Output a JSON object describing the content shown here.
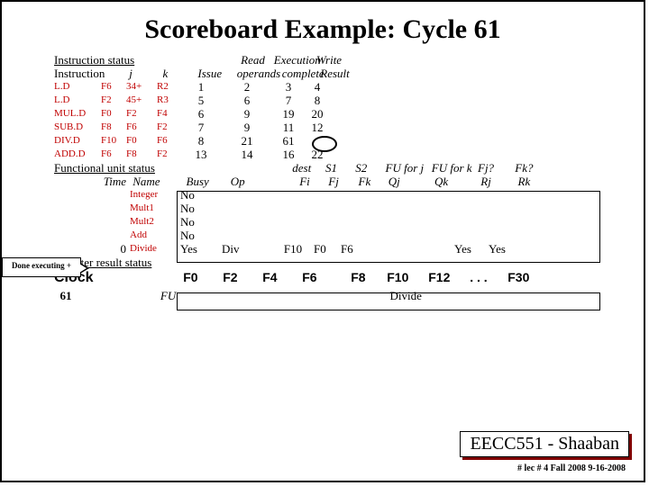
{
  "title": "Scoreboard Example:  Cycle 61",
  "headers": {
    "instr_status": "Instruction status",
    "instruction": "Instruction",
    "j": "j",
    "k": "k",
    "issue": "Issue",
    "read": "Read",
    "operands": "operands",
    "execution": "Execution",
    "complete": "complete",
    "write": "Write",
    "result": "Result",
    "fu_status": "Functional unit status",
    "time": "Time",
    "name": "Name",
    "busy": "Busy",
    "op": "Op",
    "dest": "dest",
    "fi": "Fi",
    "s1": "S1",
    "fj": "Fj",
    "s2": "S2",
    "fk": "Fk",
    "fu_j": "FU for j",
    "fu_k": "FU for k",
    "qj": "Qj",
    "qk": "Qk",
    "fjq": "Fj?",
    "rj": "Rj",
    "fkq": "Fk?",
    "rk": "Rk",
    "reg_status": "Register result status",
    "clock": "Clock",
    "fu": "FU"
  },
  "instructions": [
    {
      "op": "L.D",
      "dst": "F6",
      "j": "34+",
      "k": "R2",
      "issue": "1",
      "read": "2",
      "exec": "3",
      "write": "4"
    },
    {
      "op": "L.D",
      "dst": "F2",
      "j": "45+",
      "k": "R3",
      "issue": "5",
      "read": "6",
      "exec": "7",
      "write": "8"
    },
    {
      "op": "MUL.D",
      "dst": "F0",
      "j": "F2",
      "k": "F4",
      "issue": "6",
      "read": "9",
      "exec": "19",
      "write": "20"
    },
    {
      "op": "SUB.D",
      "dst": "F8",
      "j": "F6",
      "k": "F2",
      "issue": "7",
      "read": "9",
      "exec": "11",
      "write": "12"
    },
    {
      "op": "DIV.D",
      "dst": "F10",
      "j": "F0",
      "k": "F6",
      "issue": "8",
      "read": "21",
      "exec": "61",
      "write": ""
    },
    {
      "op": "ADD.D",
      "dst": "F6",
      "j": "F8",
      "k": "F2",
      "issue": "13",
      "read": "14",
      "exec": "16",
      "write": "22"
    }
  ],
  "fu_rows": [
    {
      "time": "",
      "name": "Integer",
      "busy": "No",
      "op": "",
      "fi": "",
      "fj": "",
      "fk": "",
      "qj": "",
      "qk": "",
      "rj": "",
      "rk": ""
    },
    {
      "time": "",
      "name": "Mult1",
      "busy": "No",
      "op": "",
      "fi": "",
      "fj": "",
      "fk": "",
      "qj": "",
      "qk": "",
      "rj": "",
      "rk": ""
    },
    {
      "time": "",
      "name": "Mult2",
      "busy": "No",
      "op": "",
      "fi": "",
      "fj": "",
      "fk": "",
      "qj": "",
      "qk": "",
      "rj": "",
      "rk": ""
    },
    {
      "time": "",
      "name": "Add",
      "busy": "No",
      "op": "",
      "fi": "",
      "fj": "",
      "fk": "",
      "qj": "",
      "qk": "",
      "rj": "",
      "rk": ""
    },
    {
      "time": "0",
      "name": "Divide",
      "busy": "Yes",
      "op": "Div",
      "fi": "F10",
      "fj": "F0",
      "fk": "F6",
      "qj": "",
      "qk": "",
      "rj": "Yes",
      "rk": "Yes"
    }
  ],
  "clock_cycle": "61",
  "reg_cols": [
    "F0",
    "F2",
    "F4",
    "F6",
    "F8",
    "F10",
    "F12",
    ". . .",
    "F30"
  ],
  "reg_vals": [
    "",
    "",
    "",
    "",
    "",
    "Divide",
    "",
    "",
    ""
  ],
  "callout": "Done executing +",
  "footer": "EECC551 - Shaaban",
  "footer_sub": "#  lec # 4  Fall 2008   9-16-2008"
}
